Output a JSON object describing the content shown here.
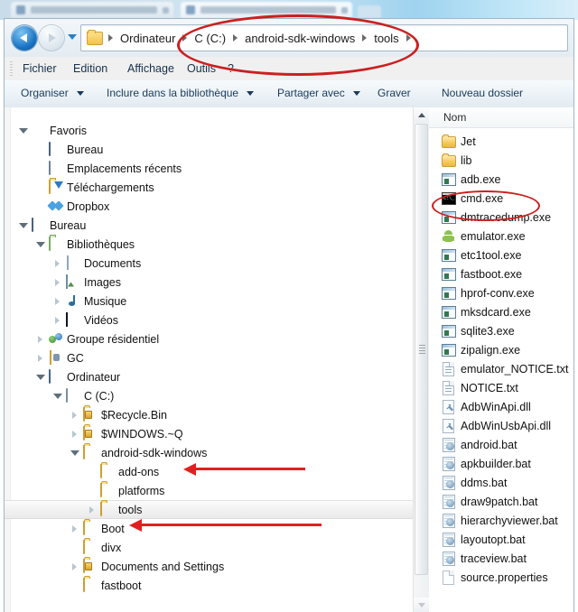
{
  "window": {
    "background_tabs": [
      "",
      ""
    ]
  },
  "address_bar": {
    "back_tooltip": "Précédent",
    "forward_tooltip": "Suivant",
    "crumbs": [
      "Ordinateur",
      "C (C:)",
      "android-sdk-windows",
      "tools"
    ]
  },
  "menu": {
    "items": [
      "Fichier",
      "Edition",
      "Affichage",
      "Outils",
      "?"
    ]
  },
  "toolbar": {
    "items": [
      {
        "label": "Organiser",
        "caret": true
      },
      {
        "label": "Inclure dans la bibliothèque",
        "caret": true
      },
      {
        "label": "Partager avec",
        "caret": true
      },
      {
        "label": "Graver",
        "caret": false
      },
      {
        "label": "Nouveau dossier",
        "caret": false
      }
    ]
  },
  "nav_tree": [
    {
      "label": "Favoris",
      "icon": "star-icon",
      "indent": 0,
      "twisty": "open",
      "selected": false
    },
    {
      "label": "Bureau",
      "icon": "monitor-icon",
      "indent": 1,
      "twisty": "none",
      "selected": false
    },
    {
      "label": "Emplacements récents",
      "icon": "recent-icon",
      "indent": 1,
      "twisty": "none",
      "selected": false
    },
    {
      "label": "Téléchargements",
      "icon": "download-icon",
      "indent": 1,
      "twisty": "none",
      "selected": false
    },
    {
      "label": "Dropbox",
      "icon": "dropbox-icon",
      "indent": 1,
      "twisty": "none",
      "selected": false
    },
    {
      "label": "Bureau",
      "icon": "monitor-icon",
      "indent": 0,
      "twisty": "open",
      "selected": false
    },
    {
      "label": "Bibliothèques",
      "icon": "library-icon",
      "indent": 1,
      "twisty": "open",
      "selected": false
    },
    {
      "label": "Documents",
      "icon": "document-icon",
      "indent": 2,
      "twisty": "closed",
      "selected": false
    },
    {
      "label": "Images",
      "icon": "picture-icon",
      "indent": 2,
      "twisty": "closed",
      "selected": false
    },
    {
      "label": "Musique",
      "icon": "music-icon",
      "indent": 2,
      "twisty": "closed",
      "selected": false
    },
    {
      "label": "Vidéos",
      "icon": "video-icon",
      "indent": 2,
      "twisty": "closed",
      "selected": false
    },
    {
      "label": "Groupe résidentiel",
      "icon": "homegroup-icon",
      "indent": 1,
      "twisty": "closed",
      "selected": false
    },
    {
      "label": "GC",
      "icon": "user-icon",
      "indent": 1,
      "twisty": "closed",
      "selected": false
    },
    {
      "label": "Ordinateur",
      "icon": "computer-icon",
      "indent": 1,
      "twisty": "open",
      "selected": false
    },
    {
      "label": "C (C:)",
      "icon": "drive-icon",
      "indent": 2,
      "twisty": "open",
      "selected": false
    },
    {
      "label": "$Recycle.Bin",
      "icon": "folder-lock-icon",
      "indent": 3,
      "twisty": "closed",
      "selected": false
    },
    {
      "label": "$WINDOWS.~Q",
      "icon": "folder-lock-icon",
      "indent": 3,
      "twisty": "closed",
      "selected": false
    },
    {
      "label": "android-sdk-windows",
      "icon": "folder-icon",
      "indent": 3,
      "twisty": "open",
      "selected": false
    },
    {
      "label": "add-ons",
      "icon": "folder-icon",
      "indent": 4,
      "twisty": "none",
      "selected": false
    },
    {
      "label": "platforms",
      "icon": "folder-icon",
      "indent": 4,
      "twisty": "none",
      "selected": false
    },
    {
      "label": "tools",
      "icon": "folder-icon",
      "indent": 4,
      "twisty": "closed",
      "selected": true
    },
    {
      "label": "Boot",
      "icon": "folder-icon",
      "indent": 3,
      "twisty": "closed",
      "selected": false
    },
    {
      "label": "divx",
      "icon": "folder-icon",
      "indent": 3,
      "twisty": "none",
      "selected": false
    },
    {
      "label": "Documents and Settings",
      "icon": "folder-lock-icon",
      "indent": 3,
      "twisty": "closed",
      "selected": false
    },
    {
      "label": "fastboot",
      "icon": "folder-icon",
      "indent": 3,
      "twisty": "none",
      "selected": false
    }
  ],
  "file_pane": {
    "column_header": "Nom",
    "items": [
      {
        "name": "Jet",
        "icon": "folder-icon"
      },
      {
        "name": "lib",
        "icon": "folder-icon"
      },
      {
        "name": "adb.exe",
        "icon": "exe-icon"
      },
      {
        "name": "cmd.exe",
        "icon": "cmd-console-icon"
      },
      {
        "name": "dmtracedump.exe",
        "icon": "exe-icon"
      },
      {
        "name": "emulator.exe",
        "icon": "android-icon"
      },
      {
        "name": "etc1tool.exe",
        "icon": "exe-icon"
      },
      {
        "name": "fastboot.exe",
        "icon": "exe-icon"
      },
      {
        "name": "hprof-conv.exe",
        "icon": "exe-icon"
      },
      {
        "name": "mksdcard.exe",
        "icon": "exe-icon"
      },
      {
        "name": "sqlite3.exe",
        "icon": "exe-icon"
      },
      {
        "name": "zipalign.exe",
        "icon": "exe-icon"
      },
      {
        "name": "emulator_NOTICE.txt",
        "icon": "text-file-icon"
      },
      {
        "name": "NOTICE.txt",
        "icon": "text-file-icon"
      },
      {
        "name": "AdbWinApi.dll",
        "icon": "dll-icon"
      },
      {
        "name": "AdbWinUsbApi.dll",
        "icon": "dll-icon"
      },
      {
        "name": "android.bat",
        "icon": "batch-file-icon"
      },
      {
        "name": "apkbuilder.bat",
        "icon": "batch-file-icon"
      },
      {
        "name": "ddms.bat",
        "icon": "batch-file-icon"
      },
      {
        "name": "draw9patch.bat",
        "icon": "batch-file-icon"
      },
      {
        "name": "hierarchyviewer.bat",
        "icon": "batch-file-icon"
      },
      {
        "name": "layoutopt.bat",
        "icon": "batch-file-icon"
      },
      {
        "name": "traceview.bat",
        "icon": "batch-file-icon"
      },
      {
        "name": "source.properties",
        "icon": "properties-file-icon"
      }
    ]
  },
  "annotations": {
    "color": "#cc1f1f",
    "arrow_color": "#e02020",
    "ellipse_address_bar_target": "android-sdk-windows \\ tools path",
    "ellipse_cmd_target": "cmd.exe",
    "arrow_1_target": "android-sdk-windows",
    "arrow_2_target": "tools"
  }
}
